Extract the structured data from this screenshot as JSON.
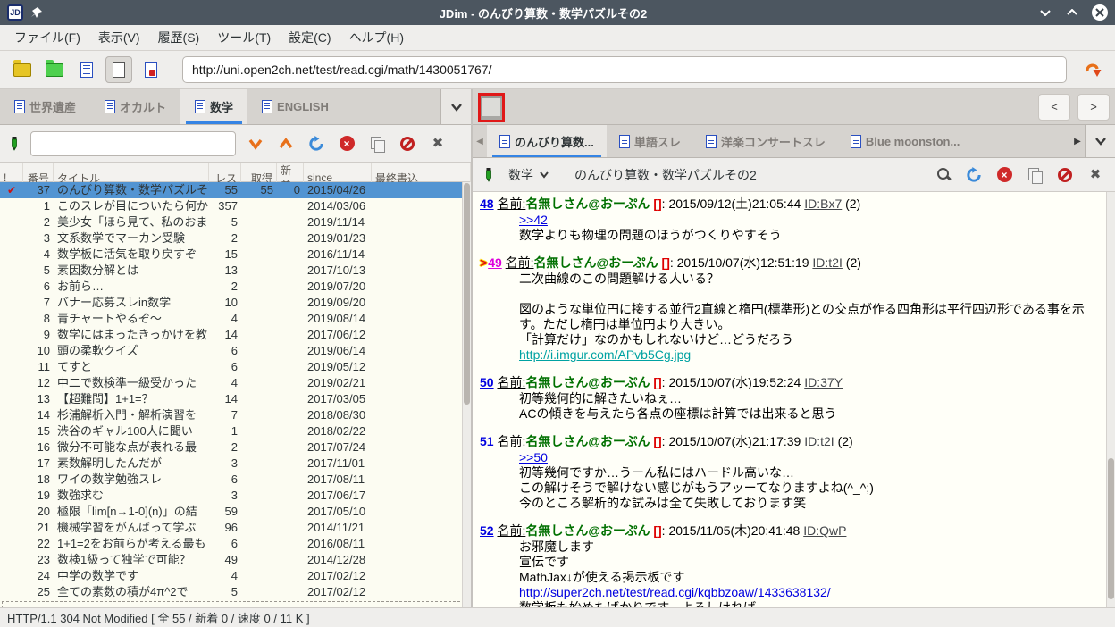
{
  "window": {
    "title": "JDim - のんびり算数・数学パズルその2"
  },
  "menubar": {
    "items": [
      "ファイル(F)",
      "表示(V)",
      "履歴(S)",
      "ツール(T)",
      "設定(C)",
      "ヘルプ(H)"
    ]
  },
  "toolbar": {
    "url": "http://uni.open2ch.net/test/read.cgi/math/1430051767/"
  },
  "board_pane": {
    "tabs": [
      {
        "label": "世界遺産",
        "active": false
      },
      {
        "label": "オカルト",
        "active": false
      },
      {
        "label": "数学",
        "active": true
      },
      {
        "label": "ENGLISH",
        "active": false
      }
    ],
    "search_value": "",
    "headers": [
      "!",
      "番号",
      "タイトル",
      "レス",
      "取得",
      "新着",
      "since",
      "最終書込"
    ],
    "rows": [
      {
        "mark": "✔",
        "num": "37",
        "title": "のんびり算数・数学パズルその2",
        "res": "55",
        "got": "55",
        "new": "0",
        "since": "2015/04/26",
        "last": "",
        "selected": true
      },
      {
        "mark": "",
        "num": "1",
        "title": "このスレが目についたら何か",
        "res": "357",
        "got": "",
        "new": "",
        "since": "2014/03/06",
        "last": "",
        "selected": false
      },
      {
        "mark": "",
        "num": "2",
        "title": "美少女「ほら見て、私のおま",
        "res": "5",
        "got": "",
        "new": "",
        "since": "2019/11/14",
        "last": "",
        "selected": false
      },
      {
        "mark": "",
        "num": "3",
        "title": "文系数学でマーカン受験",
        "res": "2",
        "got": "",
        "new": "",
        "since": "2019/01/23",
        "last": "",
        "selected": false
      },
      {
        "mark": "",
        "num": "4",
        "title": "数学板に活気を取り戻すぞ",
        "res": "15",
        "got": "",
        "new": "",
        "since": "2016/11/14",
        "last": "",
        "selected": false
      },
      {
        "mark": "",
        "num": "5",
        "title": "素因数分解とは",
        "res": "13",
        "got": "",
        "new": "",
        "since": "2017/10/13",
        "last": "",
        "selected": false
      },
      {
        "mark": "",
        "num": "6",
        "title": "お前ら…",
        "res": "2",
        "got": "",
        "new": "",
        "since": "2019/07/20",
        "last": "",
        "selected": false
      },
      {
        "mark": "",
        "num": "7",
        "title": "バナー応募スレin数学",
        "res": "10",
        "got": "",
        "new": "",
        "since": "2019/09/20",
        "last": "",
        "selected": false
      },
      {
        "mark": "",
        "num": "8",
        "title": "青チャートやるぞ～",
        "res": "4",
        "got": "",
        "new": "",
        "since": "2019/08/14",
        "last": "",
        "selected": false
      },
      {
        "mark": "",
        "num": "9",
        "title": "数学にはまったきっかけを教",
        "res": "14",
        "got": "",
        "new": "",
        "since": "2017/06/12",
        "last": "",
        "selected": false
      },
      {
        "mark": "",
        "num": "10",
        "title": "頭の柔軟クイズ",
        "res": "6",
        "got": "",
        "new": "",
        "since": "2019/06/14",
        "last": "",
        "selected": false
      },
      {
        "mark": "",
        "num": "11",
        "title": "てすと",
        "res": "6",
        "got": "",
        "new": "",
        "since": "2019/05/12",
        "last": "",
        "selected": false
      },
      {
        "mark": "",
        "num": "12",
        "title": "中二で数検準一級受かった",
        "res": "4",
        "got": "",
        "new": "",
        "since": "2019/02/21",
        "last": "",
        "selected": false
      },
      {
        "mark": "",
        "num": "13",
        "title": "【超難問】1+1=？",
        "res": "14",
        "got": "",
        "new": "",
        "since": "2017/03/05",
        "last": "",
        "selected": false
      },
      {
        "mark": "",
        "num": "14",
        "title": "杉浦解析入門・解析演習を",
        "res": "7",
        "got": "",
        "new": "",
        "since": "2018/08/30",
        "last": "",
        "selected": false
      },
      {
        "mark": "",
        "num": "15",
        "title": "渋谷のギャル100人に聞い",
        "res": "1",
        "got": "",
        "new": "",
        "since": "2018/02/22",
        "last": "",
        "selected": false
      },
      {
        "mark": "",
        "num": "16",
        "title": "微分不可能な点が表れる最",
        "res": "2",
        "got": "",
        "new": "",
        "since": "2017/07/24",
        "last": "",
        "selected": false
      },
      {
        "mark": "",
        "num": "17",
        "title": "素数解明したんだが",
        "res": "3",
        "got": "",
        "new": "",
        "since": "2017/11/01",
        "last": "",
        "selected": false
      },
      {
        "mark": "",
        "num": "18",
        "title": "ワイの数学勉強スレ",
        "res": "6",
        "got": "",
        "new": "",
        "since": "2017/08/11",
        "last": "",
        "selected": false
      },
      {
        "mark": "",
        "num": "19",
        "title": "数強求む",
        "res": "3",
        "got": "",
        "new": "",
        "since": "2017/06/17",
        "last": "",
        "selected": false
      },
      {
        "mark": "",
        "num": "20",
        "title": "極限「lim[n→1-0](n)」の結",
        "res": "59",
        "got": "",
        "new": "",
        "since": "2017/05/10",
        "last": "",
        "selected": false
      },
      {
        "mark": "",
        "num": "21",
        "title": "機械学習をがんばって学ぶ",
        "res": "96",
        "got": "",
        "new": "",
        "since": "2014/11/21",
        "last": "",
        "selected": false
      },
      {
        "mark": "",
        "num": "22",
        "title": "1+1=2をお前らが考える最も",
        "res": "6",
        "got": "",
        "new": "",
        "since": "2016/08/11",
        "last": "",
        "selected": false
      },
      {
        "mark": "",
        "num": "23",
        "title": "数検1級って独学で可能？",
        "res": "49",
        "got": "",
        "new": "",
        "since": "2014/12/28",
        "last": "",
        "selected": false
      },
      {
        "mark": "",
        "num": "24",
        "title": "中学の数学です",
        "res": "4",
        "got": "",
        "new": "",
        "since": "2017/02/12",
        "last": "",
        "selected": false
      },
      {
        "mark": "",
        "num": "25",
        "title": "全ての素数の積が4π^2で",
        "res": "5",
        "got": "",
        "new": "",
        "since": "2017/02/12",
        "last": "",
        "selected": false
      }
    ]
  },
  "thread_pane": {
    "tabs": [
      {
        "label": "のんびり算数...",
        "active": true
      },
      {
        "label": "単語スレ",
        "active": false
      },
      {
        "label": "洋楽コンサートスレ",
        "active": false
      },
      {
        "label": "Blue moonston...",
        "active": false
      }
    ],
    "board_select": "数学",
    "title": "のんびり算数・数学パズルその2",
    "posts": [
      {
        "num": "48",
        "visited": false,
        "marker": false,
        "name_label": "名前:",
        "name": "名無しさん@おーぷん",
        "mail": "[]",
        "sep": ":",
        "date": "2015/09/12(土)21:05:44",
        "id": "ID:Bx7",
        "count": "(2)",
        "lines": [
          {
            "t": "anchor",
            "text": ">>42"
          },
          {
            "t": "text",
            "text": "数学よりも物理の問題のほうがつくりやすそう"
          }
        ]
      },
      {
        "num": "49",
        "visited": true,
        "marker": true,
        "name_label": "名前:",
        "name": "名無しさん@おーぷん",
        "mail": "[]",
        "sep": ":",
        "date": "2015/10/07(水)12:51:19",
        "id": "ID:t2I",
        "count": "(2)",
        "lines": [
          {
            "t": "text",
            "text": "二次曲線のこの問題解ける人いる？"
          },
          {
            "t": "blank",
            "text": ""
          },
          {
            "t": "text",
            "text": "図のような単位円に接する並行2直線と楕円(標準形)との交点が作る四角形は平行四辺形である事を示す。ただし楕円は単位円より大きい。"
          },
          {
            "t": "text",
            "text": "「計算だけ」なのかもしれないけど…どうだろう"
          },
          {
            "t": "url_teal",
            "text": "http://i.imgur.com/APvb5Cg.jpg"
          }
        ]
      },
      {
        "num": "50",
        "visited": false,
        "marker": false,
        "name_label": "名前:",
        "name": "名無しさん@おーぷん",
        "mail": "[]",
        "sep": ":",
        "date": "2015/10/07(水)19:52:24",
        "id": "ID:37Y",
        "count": "",
        "lines": [
          {
            "t": "text",
            "text": "初等幾何的に解きたいねぇ…"
          },
          {
            "t": "text",
            "text": "ACの傾きを与えたら各点の座標は計算では出来ると思う"
          }
        ]
      },
      {
        "num": "51",
        "visited": false,
        "marker": false,
        "name_label": "名前:",
        "name": "名無しさん@おーぷん",
        "mail": "[]",
        "sep": ":",
        "date": "2015/10/07(水)21:17:39",
        "id": "ID:t2I",
        "count": "(2)",
        "lines": [
          {
            "t": "anchor",
            "text": ">>50"
          },
          {
            "t": "text",
            "text": "初等幾何ですか…うーん私にはハードル高いな…"
          },
          {
            "t": "text",
            "text": "この解けそうで解けない感じがもうアッーてなりますよね(^_^;)"
          },
          {
            "t": "text",
            "text": "今のところ解析的な試みは全て失敗しております笑"
          }
        ]
      },
      {
        "num": "52",
        "visited": false,
        "marker": false,
        "name_label": "名前:",
        "name": "名無しさん@おーぷん",
        "mail": "[]",
        "sep": ":",
        "date": "2015/11/05(木)20:41:48",
        "id": "ID:QwP",
        "count": "",
        "lines": [
          {
            "t": "text",
            "text": "お邪魔します"
          },
          {
            "t": "text",
            "text": "宣伝です"
          },
          {
            "t": "text",
            "text": "MathJax↓が使える掲示板です"
          },
          {
            "t": "url",
            "text": "http://super2ch.net/test/read.cgi/kqbbzoaw/1433638132/"
          },
          {
            "t": "clip",
            "text": "数学板も始めたばかりです、よろしければ"
          }
        ]
      }
    ]
  },
  "statusbar": {
    "text": "HTTP/1.1 304 Not Modified [ 全 55 / 新着 0 / 速度 0 / 11 K ]"
  },
  "colors": {
    "accent": "#3584e4",
    "link": "#0000e0",
    "visited": "#dd00dd",
    "name_green": "#007000",
    "mail_red": "#dd0000",
    "selection": "#5294d2"
  }
}
